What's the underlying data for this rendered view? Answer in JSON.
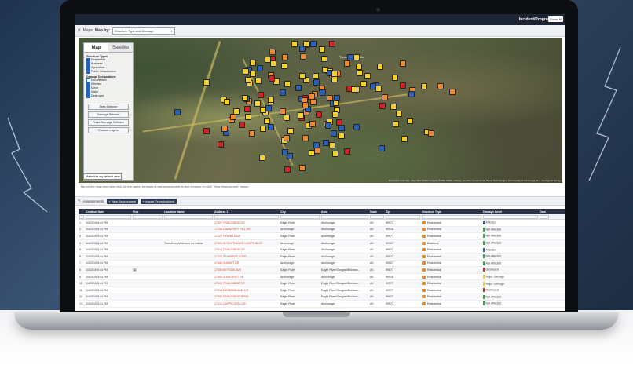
{
  "topbar": {
    "user": "Incident/Program",
    "button": "Guest M"
  },
  "maps_bar": {
    "label": "Maps",
    "map_by_label": "Map by:",
    "map_by_value": "Structure Type and Damage"
  },
  "map": {
    "tabs": [
      "Map",
      "Satellite"
    ],
    "structure_types_title": "Structure Types",
    "structure_types": [
      "Residential",
      "Business",
      "Agriculture",
      "Public Infrastructure"
    ],
    "damage_title": "Damage Designations",
    "damage_levels": [
      "Not Affected",
      "Affected",
      "Minor",
      "Major",
      "Destroyed"
    ],
    "buttons": [
      "Area Selector",
      "Damage Selector",
      "Road Damage Selector",
      "Custom Layers"
    ],
    "default_view_button": "Make this my default view",
    "town_label": "Thunderbird Falls",
    "attribution": "Keyboard shortcuts · Map data ©2022 Imagery ©2022 CNES / Airbus, Landsat / Copernicus, Maxar Technologies, Municipality of Anchorage, U.S. Geological Survey",
    "colors": {
      "affected": "#2a61b8",
      "minor": "#f3d12a",
      "major": "#f08a2a",
      "destroyed": "#d32424",
      "not_affected": "#c8c8c8"
    }
  },
  "hint": "Tap on the map and right click for the option to begin a new assessment at that location or click \"New Assessment\" below",
  "assessments": {
    "label": "Assessments",
    "new_button": "+ New Assessment",
    "import_button": "+ Import From Incident"
  },
  "table": {
    "columns": [
      "",
      "Creation Date",
      "Pics",
      "Location Name",
      "Address 1",
      "City",
      "Area",
      "State",
      "Zip",
      "Structure Type",
      "Damage Level",
      "Dam"
    ],
    "rows": [
      [
        "1",
        "1/4/2019 5:44 PM",
        "",
        "",
        "17527 TRAILRIDGE DR",
        "Eagle River",
        "Anchorage",
        "AK",
        "99577",
        "Residential",
        "Affected"
      ],
      [
        "2",
        "1/4/2019 5:44 PM",
        "",
        "",
        "17755 CHANCERY HILL DR",
        "Anchorage",
        "Anchorage",
        "AK",
        "99516",
        "Residential",
        "Not Affected"
      ],
      [
        "3",
        "1/4/2019 5:44 PM",
        "",
        "",
        "17127 HEIGHTS DR",
        "Eagle River",
        "Anchorage",
        "AK",
        "99577",
        "Residential",
        "Not Affected"
      ],
      [
        "4",
        "1/4/2019 5:44 PM",
        "",
        "Templeton Anderson Ice Arena",
        "17001 W SOUTHGATE LOOPS BLVD",
        "Anchorage",
        "Anchorage",
        "AK",
        "99507",
        "Business",
        "Not Affected"
      ],
      [
        "5",
        "1/4/2019 5:44 PM",
        "",
        "",
        "17614 TRAILRIDGE DR",
        "Eagle River",
        "Anchorage",
        "AK",
        "99577",
        "Residential",
        "Affected"
      ],
      [
        "6",
        "1/4/2019 5:44 PM",
        "",
        "",
        "17101 S HARBOR LOOP",
        "Eagle River",
        "Anchorage",
        "AK",
        "99577",
        "Residential",
        "Not Affected"
      ],
      [
        "7",
        "1/4/2019 5:44 PM",
        "",
        "",
        "17440 SUMMIT DR",
        "Anchorage",
        "Anchorage",
        "AK",
        "99507",
        "Residential",
        "Not Affected"
      ],
      [
        "8",
        "1/4/2019 5:44 PM",
        "img",
        "",
        "17000 KEYSIDE AVE",
        "Eagle River",
        "Eagle River/Chugiak/Birchwo...",
        "AK",
        "99577",
        "Residential",
        "Destroyed"
      ],
      [
        "9",
        "1/4/2019 5:44 PM",
        "",
        "",
        "17000 SOMERSET DR",
        "Anchorage",
        "Anchorage",
        "AK",
        "99516",
        "Residential",
        "Major Damage"
      ],
      [
        "10",
        "1/4/2019 5:44 PM",
        "",
        "",
        "17101 TRAILRIDGE DR",
        "Eagle River",
        "Eagle River/Chugiak/Birchwo...",
        "AK",
        "99577",
        "Residential",
        "Major Damage"
      ],
      [
        "11",
        "1/4/2019 5:44 PM",
        "",
        "",
        "17014 MEADOWLAND DR",
        "Eagle River",
        "Eagle River/Chugiak/Birchwo...",
        "AK",
        "99577",
        "Residential",
        "Destroyed"
      ],
      [
        "12",
        "1/4/2019 5:44 PM",
        "",
        "",
        "17001 TRAILRIDGE BEND",
        "Eagle River",
        "Eagle River/Chugiak/Birchwo...",
        "AK",
        "99577",
        "Residential",
        "Not Affected"
      ],
      [
        "13",
        "1/4/2019 5:44 PM",
        "",
        "",
        "17212 CAPRICORN CIR",
        "Eagle River",
        "Anchorage",
        "AK",
        "99577",
        "Residential",
        "Not Affected"
      ]
    ]
  }
}
